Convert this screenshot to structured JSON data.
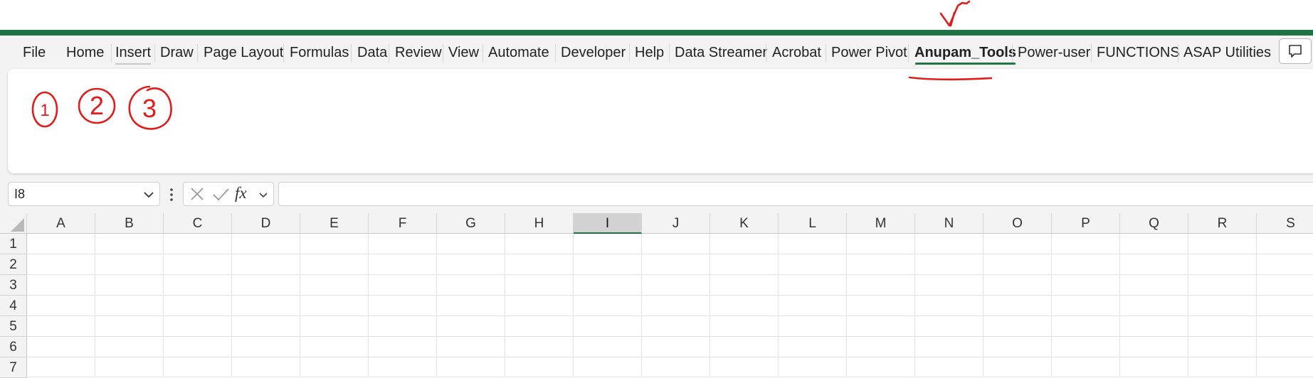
{
  "colors": {
    "accent": "#217346",
    "annotation": "#e31b1b"
  },
  "tabs": [
    {
      "label": "File"
    },
    {
      "label": "Home"
    },
    {
      "label": "Insert"
    },
    {
      "label": "Draw"
    },
    {
      "label": "Page Layout"
    },
    {
      "label": "Formulas"
    },
    {
      "label": "Data"
    },
    {
      "label": "Review"
    },
    {
      "label": "View"
    },
    {
      "label": "Automate"
    },
    {
      "label": "Developer"
    },
    {
      "label": "Help"
    },
    {
      "label": "Data Streamer"
    },
    {
      "label": "Acrobat"
    },
    {
      "label": "Power Pivot"
    },
    {
      "label": "Anupam_Tools"
    },
    {
      "label": "Power-user"
    },
    {
      "label": "FUNCTIONS"
    },
    {
      "label": "ASAP Utilities"
    }
  ],
  "active_tab": "Anupam_Tools",
  "comments_icon": "comment-icon",
  "name_box": {
    "value": "I8"
  },
  "formula_bar": {
    "value": "",
    "fx_label": "fx"
  },
  "columns": [
    "A",
    "B",
    "C",
    "D",
    "E",
    "F",
    "G",
    "H",
    "I",
    "J",
    "K",
    "L",
    "M",
    "N",
    "O",
    "P",
    "Q",
    "R",
    "S"
  ],
  "selected_column": "I",
  "rows": [
    "1",
    "2",
    "3",
    "4",
    "5",
    "6",
    "7"
  ],
  "annotations": {
    "circled_numbers": [
      "1",
      "2",
      "3"
    ]
  }
}
